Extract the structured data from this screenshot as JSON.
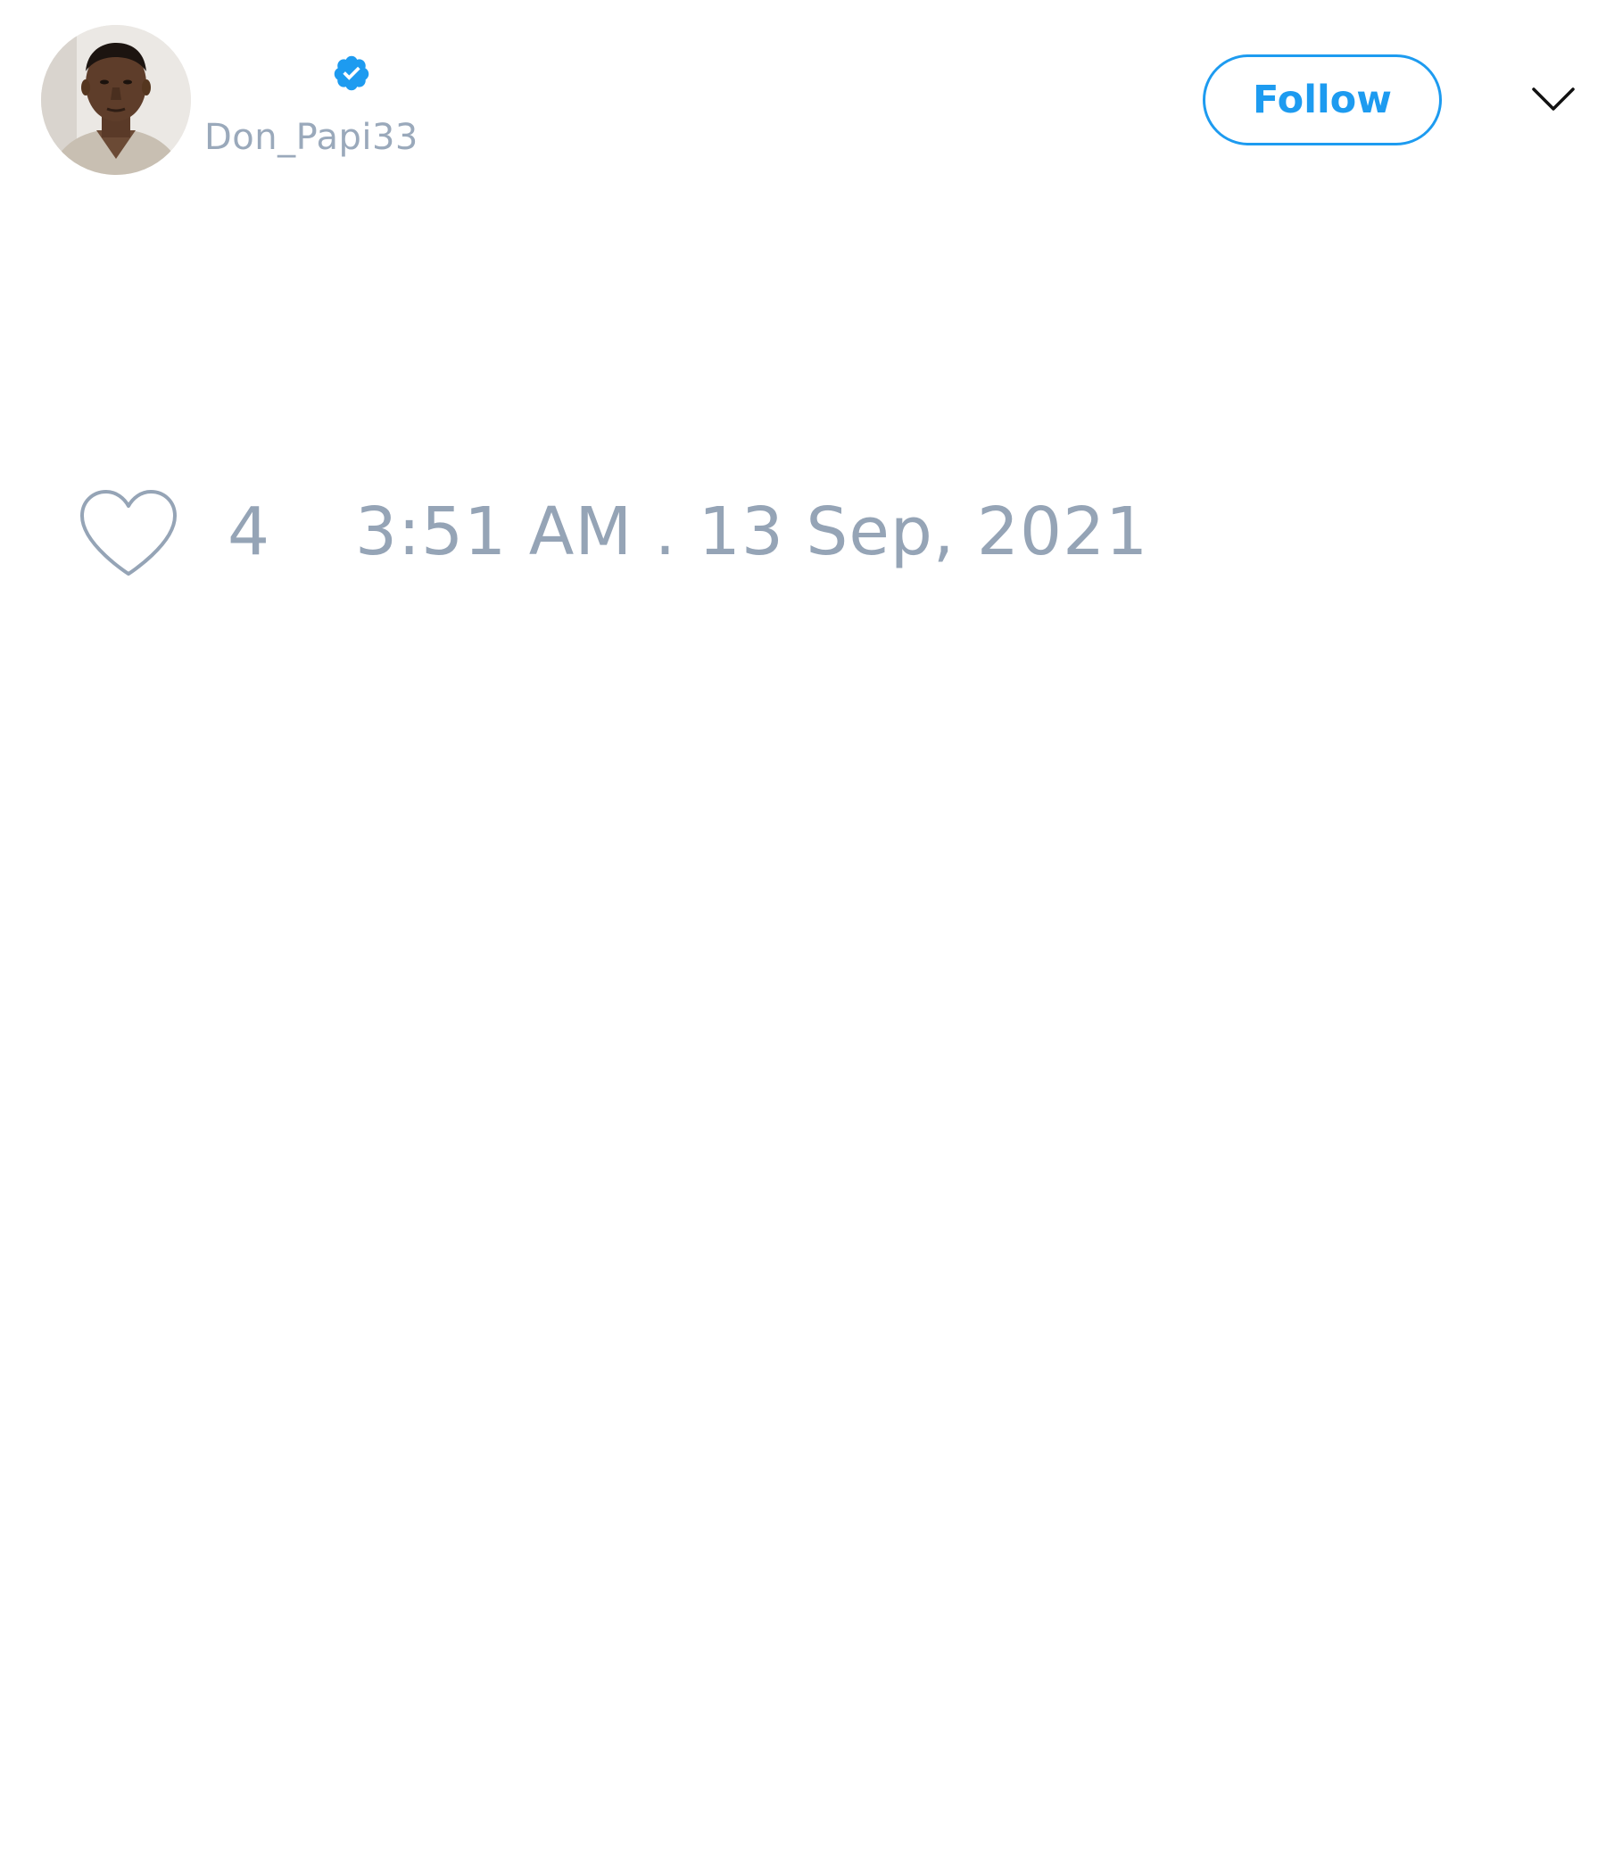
{
  "tweet": {
    "author": {
      "username": "Don_Papi33",
      "verified": true,
      "avatar_icon": "user-avatar-photo"
    },
    "follow_label": "Follow",
    "menu_icon": "chevron-down-icon",
    "like_icon": "heart-outline-icon",
    "like_count": "4",
    "timestamp": "3:51 AM . 13 Sep, 2021"
  },
  "colors": {
    "accent": "#1d9bf0",
    "muted_text": "#95a4b6",
    "background": "#ffffff"
  }
}
